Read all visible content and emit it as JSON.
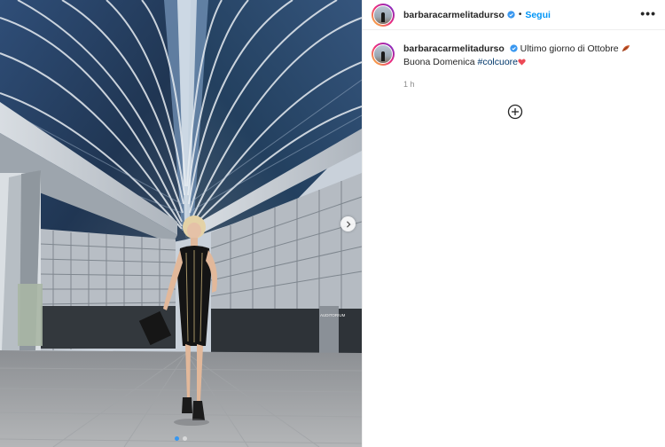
{
  "post": {
    "username": "barbaracarmelitadurso",
    "follow_label": "Segui",
    "bullet": "•",
    "more_label": "•••",
    "caption": {
      "username": "barbaracarmelitadurso",
      "text_part1": "Ultimo giorno di Ottobre",
      "text_part2": "Buona Domenica",
      "hashtag": "#colcuore"
    },
    "time_ago": "1 h",
    "carousel": {
      "slide_count": 2,
      "active_index": 0
    },
    "photo": {
      "sign_text": "AUDITORIUM"
    }
  },
  "colors": {
    "follow": "#0095f6",
    "verified": "#3897f0",
    "hashtag": "#00376b",
    "heart": "#ed4956"
  },
  "icons": [
    "verified-badge-icon",
    "more-options-icon",
    "leaf-emoji-icon",
    "heart-emoji-icon",
    "add-comment-icon",
    "chevron-right-icon"
  ]
}
